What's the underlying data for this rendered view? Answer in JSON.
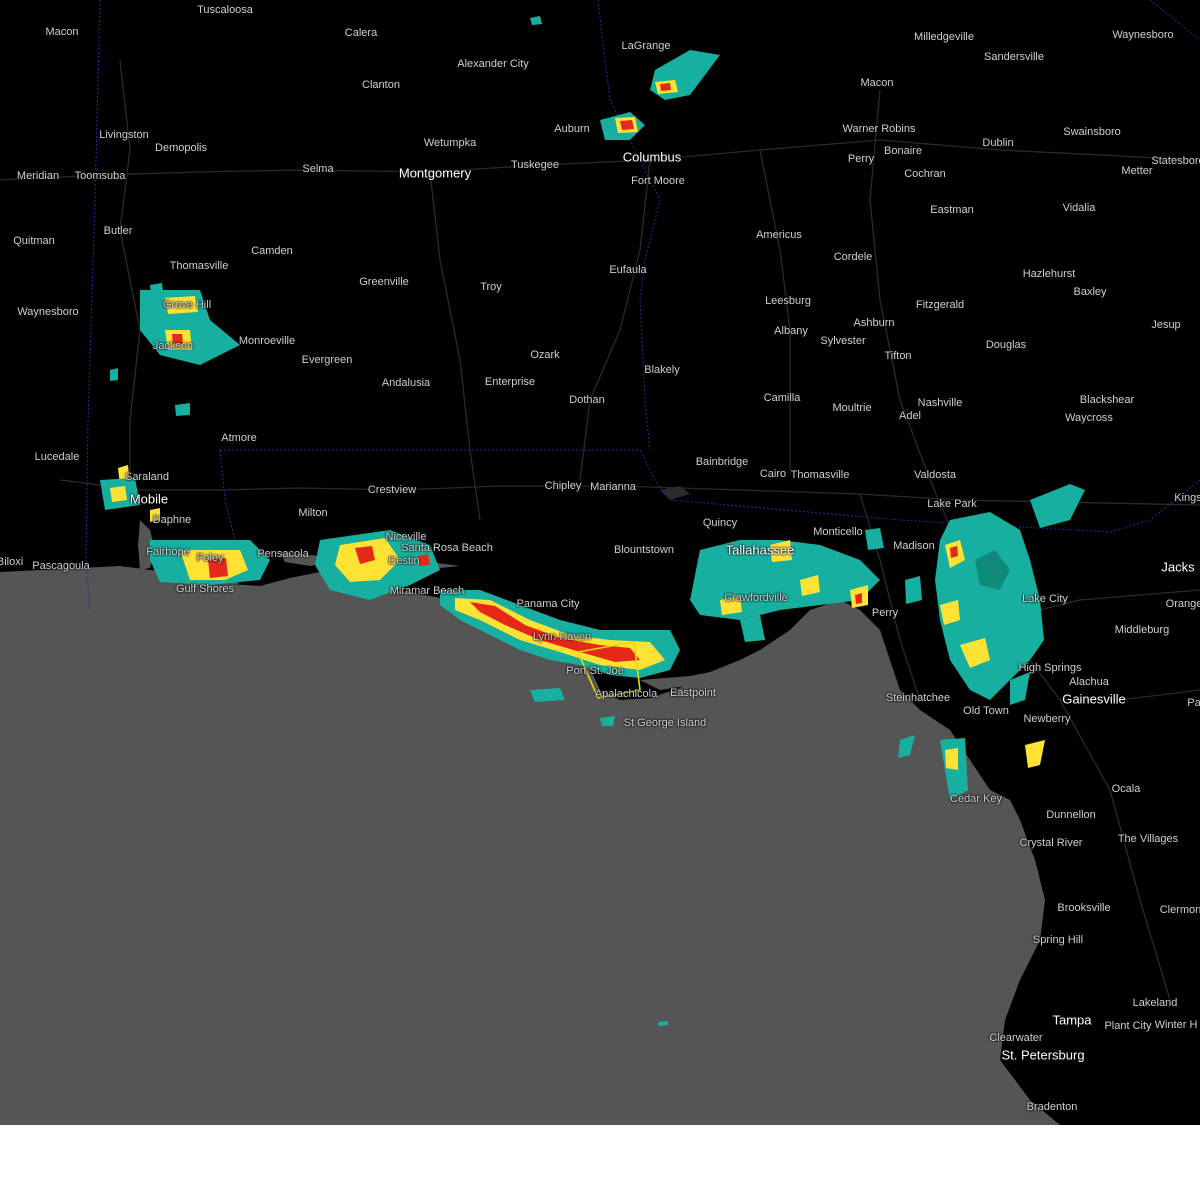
{
  "map": {
    "colors": {
      "land": "#000000",
      "water": "#555555",
      "roads": "#2a2a2a",
      "state_border": "#2a2aa0",
      "warning_polygon": "#e8d800",
      "radar_light": "#17b0a0",
      "radar_mid": "#ffe233",
      "radar_high": "#e62818"
    },
    "cities": [
      {
        "name": "Tuscaloosa"
      },
      {
        "name": "Macon"
      },
      {
        "name": "Calera"
      },
      {
        "name": "LaGrange"
      },
      {
        "name": "Milledgeville"
      },
      {
        "name": "Waynesboro"
      },
      {
        "name": "Sandersville"
      },
      {
        "name": "Alexander City"
      },
      {
        "name": "Clanton"
      },
      {
        "name": "Livingston"
      },
      {
        "name": "Demopolis"
      },
      {
        "name": "Wetumpka"
      },
      {
        "name": "Auburn"
      },
      {
        "name": "Columbus"
      },
      {
        "name": "Macon"
      },
      {
        "name": "Warner Robins"
      },
      {
        "name": "Swainsboro"
      },
      {
        "name": "Dublin"
      },
      {
        "name": "Bonaire"
      },
      {
        "name": "Perry"
      },
      {
        "name": "Statesboro"
      },
      {
        "name": "Meridian"
      },
      {
        "name": "Toomsuba"
      },
      {
        "name": "Selma"
      },
      {
        "name": "Montgomery"
      },
      {
        "name": "Tuskegee"
      },
      {
        "name": "Cochran"
      },
      {
        "name": "Metter"
      },
      {
        "name": "Fort Moore"
      },
      {
        "name": "Eastman"
      },
      {
        "name": "Vidalia"
      },
      {
        "name": "Butler"
      },
      {
        "name": "Quitman"
      },
      {
        "name": "Camden"
      },
      {
        "name": "Americus"
      },
      {
        "name": "Cordele"
      },
      {
        "name": "Thomasville"
      },
      {
        "name": "Eufaula"
      },
      {
        "name": "Hazlehurst"
      },
      {
        "name": "Greenville"
      },
      {
        "name": "Troy"
      },
      {
        "name": "Baxley"
      },
      {
        "name": "Leesburg"
      },
      {
        "name": "Fitzgerald"
      },
      {
        "name": "Jesup"
      },
      {
        "name": "Grove Hill"
      },
      {
        "name": "Waynesboro"
      },
      {
        "name": "Ashburn"
      },
      {
        "name": "Albany"
      },
      {
        "name": "Monroeville"
      },
      {
        "name": "Jackson"
      },
      {
        "name": "Sylvester"
      },
      {
        "name": "Douglas"
      },
      {
        "name": "Evergreen"
      },
      {
        "name": "Tifton"
      },
      {
        "name": "Ozark"
      },
      {
        "name": "Enterprise"
      },
      {
        "name": "Blakely"
      },
      {
        "name": "Andalusia"
      },
      {
        "name": "Dothan"
      },
      {
        "name": "Camilla"
      },
      {
        "name": "Blackshear"
      },
      {
        "name": "Nashville"
      },
      {
        "name": "Moultrie"
      },
      {
        "name": "Adel"
      },
      {
        "name": "Waycross"
      },
      {
        "name": "Atmore"
      },
      {
        "name": "Lucedale"
      },
      {
        "name": "Bainbridge"
      },
      {
        "name": "Cairo"
      },
      {
        "name": "Thomasville"
      },
      {
        "name": "Valdosta"
      },
      {
        "name": "Saraland"
      },
      {
        "name": "Crestview"
      },
      {
        "name": "Chipley"
      },
      {
        "name": "Marianna"
      },
      {
        "name": "Lake Park"
      },
      {
        "name": "Kings"
      },
      {
        "name": "Mobile"
      },
      {
        "name": "Milton"
      },
      {
        "name": "Daphne"
      },
      {
        "name": "Quincy"
      },
      {
        "name": "Niceville"
      },
      {
        "name": "Monticello"
      },
      {
        "name": "Fairhope"
      },
      {
        "name": "Foley"
      },
      {
        "name": "Pensacola"
      },
      {
        "name": "Santa Rosa Beach"
      },
      {
        "name": "Blountstown"
      },
      {
        "name": "Tallahassee"
      },
      {
        "name": "Madison"
      },
      {
        "name": "Destin"
      },
      {
        "name": "Jacks"
      },
      {
        "name": "Pascagoula"
      },
      {
        "name": "Biloxi"
      },
      {
        "name": "Miramar Beach"
      },
      {
        "name": "Gulf Shores"
      },
      {
        "name": "Crawfordville"
      },
      {
        "name": "Lake City"
      },
      {
        "name": "Orange"
      },
      {
        "name": "Panama City"
      },
      {
        "name": "Perry"
      },
      {
        "name": "Middleburg"
      },
      {
        "name": "Port St. Joe"
      },
      {
        "name": "High Springs"
      },
      {
        "name": "Apalachicola"
      },
      {
        "name": "Eastpoint"
      },
      {
        "name": "Alachua"
      },
      {
        "name": "Steinhatchee"
      },
      {
        "name": "Gainesville"
      },
      {
        "name": "St George Island"
      },
      {
        "name": "Old Town"
      },
      {
        "name": "Newberry"
      },
      {
        "name": "Cedar Key"
      },
      {
        "name": "Ocala"
      },
      {
        "name": "Dunnellon"
      },
      {
        "name": "Crystal River"
      },
      {
        "name": "The Villages"
      },
      {
        "name": "Brooksville"
      },
      {
        "name": "Clermont"
      },
      {
        "name": "Spring Hill"
      },
      {
        "name": "Lakeland"
      },
      {
        "name": "Tampa"
      },
      {
        "name": "Plant City"
      },
      {
        "name": "Winter H"
      },
      {
        "name": "Clearwater"
      },
      {
        "name": "St. Petersburg"
      },
      {
        "name": "Bradenton"
      },
      {
        "name": "Lynn Haven"
      },
      {
        "name": "Pa"
      }
    ]
  }
}
